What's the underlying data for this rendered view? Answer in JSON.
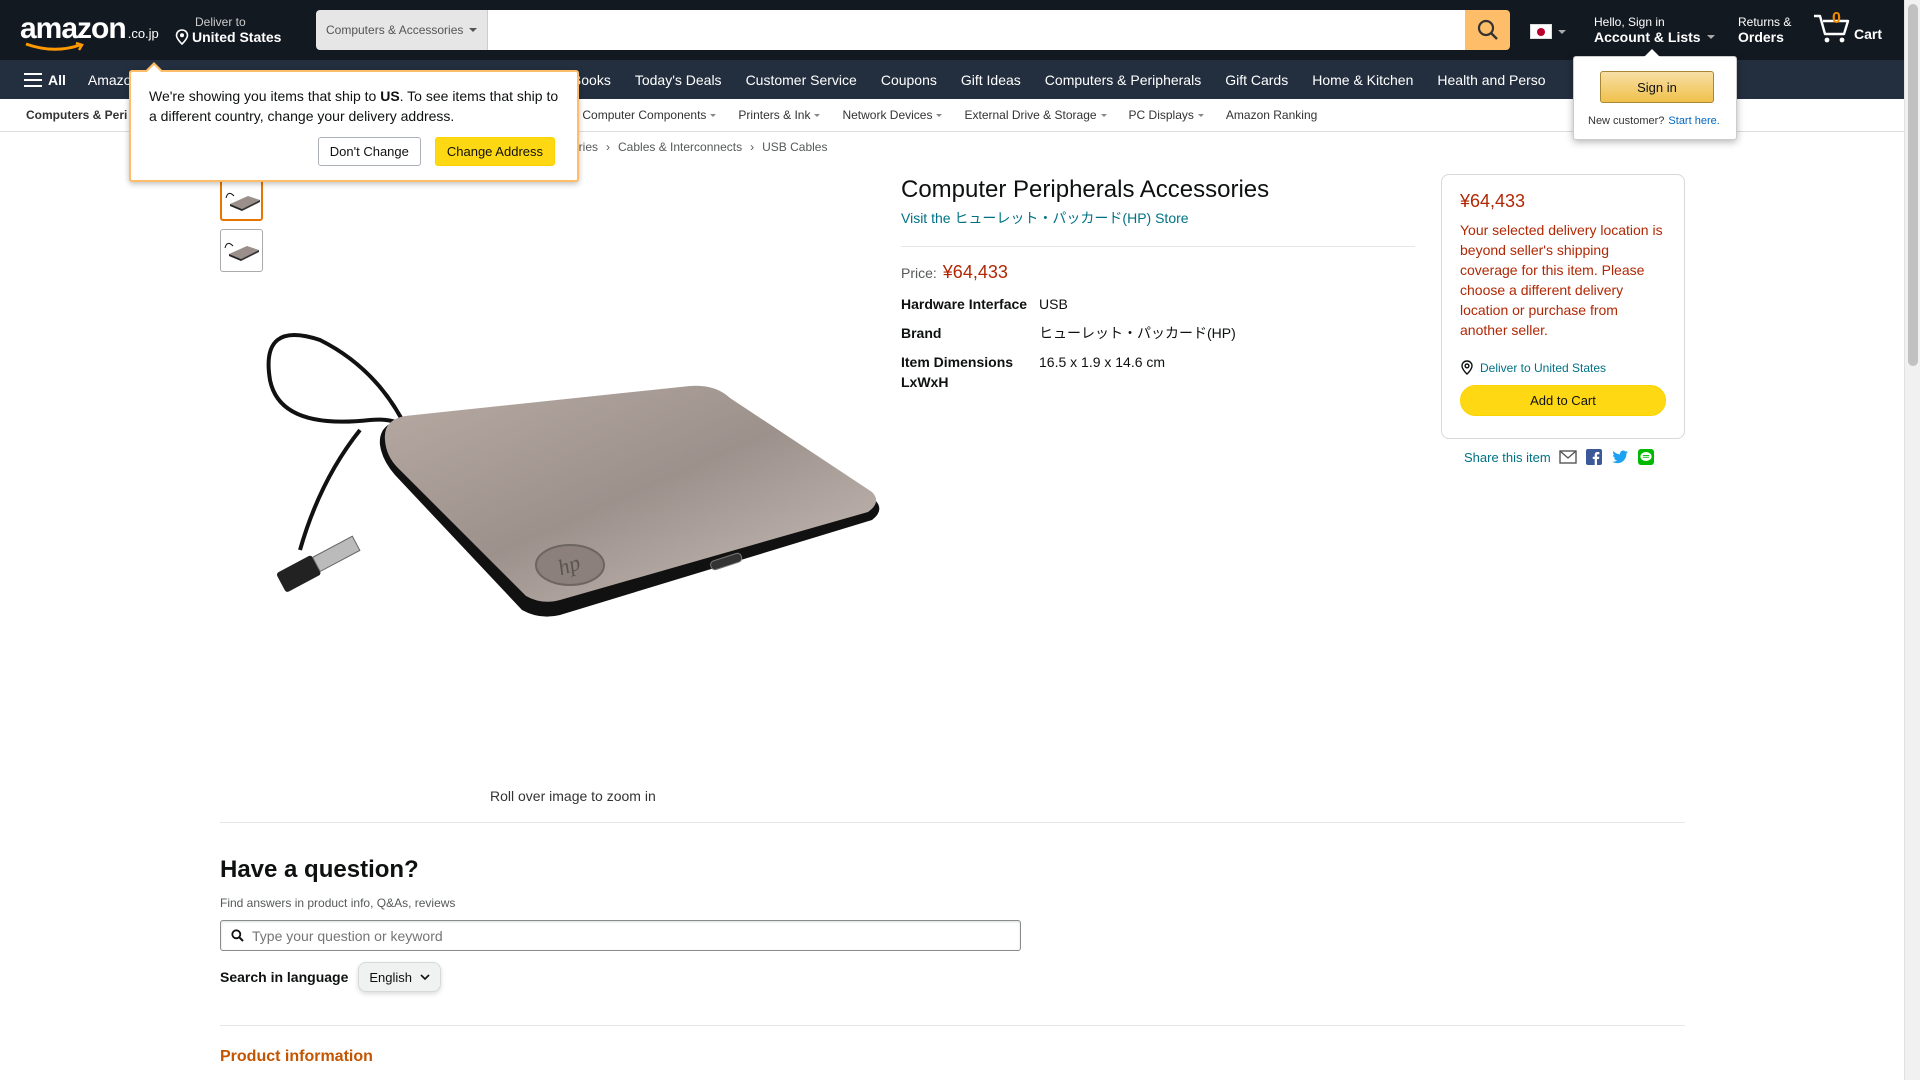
{
  "header": {
    "logo": {
      "word": "amazon",
      "tld": ".co.jp"
    },
    "deliver": {
      "line1": "Deliver to",
      "line2": "United States"
    },
    "search": {
      "category": "Computers & Accessories",
      "placeholder": ""
    },
    "account": {
      "line1": "Hello, Sign in",
      "line2": "Account & Lists"
    },
    "returns": {
      "line1": "Returns &",
      "line2": "Orders"
    },
    "cart": {
      "count": "0",
      "label": "Cart"
    }
  },
  "nav_main": {
    "all_label": "All",
    "items": [
      "Amazo",
      "ese Books",
      "Today's Deals",
      "Customer Service",
      "Coupons",
      "Gift Ideas",
      "Computers & Peripherals",
      "Gift Cards",
      "Home & Kitchen",
      "Health and Perso"
    ]
  },
  "nav_sub": {
    "items": [
      "Computers & Peri",
      "Computer Components",
      "Printers & Ink",
      "Network Devices",
      "External Drive & Storage",
      "PC Displays",
      "Amazon Ranking"
    ]
  },
  "breadcrumb": [
    "ssories",
    "Cables & Interconnects",
    "USB Cables"
  ],
  "product": {
    "title": "Computer Peripherals Accessories",
    "store_link": "Visit the ヒューレット・パッカード(HP) Store",
    "price_label": "Price:",
    "price": "¥64,433",
    "zoom_hint": "Roll over image to zoom in",
    "specs": [
      {
        "key": "Hardware Interface",
        "value": "USB"
      },
      {
        "key": "Brand",
        "value": "ヒューレット・パッカード(HP)"
      },
      {
        "key": "Item Dimensions LxWxH",
        "value": "16.5 x 1.9 x 14.6 cm"
      }
    ]
  },
  "buybox": {
    "price": "¥64,433",
    "warning": "Your selected delivery location is beyond seller's shipping coverage for this item. Please choose a different delivery location or purchase from another seller.",
    "deliver_to": "Deliver to United States",
    "add_to_cart": "Add to Cart",
    "share_label": "Share this item"
  },
  "questions": {
    "heading": "Have a question?",
    "sub": "Find answers in product info, Q&As, reviews",
    "placeholder": "Type your question or keyword",
    "lang_label": "Search in language",
    "lang_value": "English"
  },
  "product_info_heading": "Product information",
  "popover_deliver": {
    "text_pre": "We're showing you items that ship to ",
    "text_bold": "US",
    "text_post": ". To see items that ship to a different country, change your delivery address.",
    "dont_change": "Don't Change",
    "change_address": "Change Address"
  },
  "popover_signin": {
    "button": "Sign in",
    "new_customer": "New customer?",
    "start_here": "Start here."
  },
  "colors": {
    "header_bg": "#131921",
    "nav_bg": "#232f3e",
    "accent_orange": "#febd69",
    "price_red": "#b12704",
    "link_teal": "#007185",
    "button_yellow": "#ffd814"
  }
}
